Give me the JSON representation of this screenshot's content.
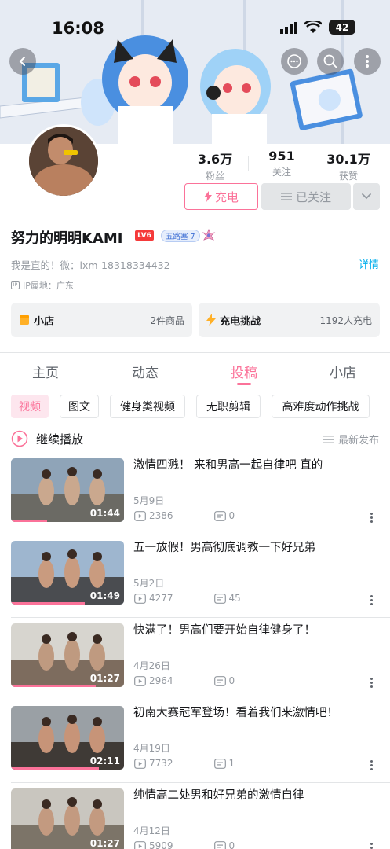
{
  "status": {
    "time": "16:08",
    "battery": "42"
  },
  "profile": {
    "stats": [
      {
        "value": "3.6万",
        "label": "粉丝"
      },
      {
        "value": "951",
        "label": "关注"
      },
      {
        "value": "30.1万",
        "label": "获赞"
      }
    ],
    "charge_label": "充电",
    "followed_label": "已关注",
    "name": "努力的明明KAMI",
    "level": "LV6",
    "fan_badge": "五路塞 7",
    "bio": "我是直的！微：lxm-18318334432",
    "detail_link": "详情",
    "ip": "IP属地：广东"
  },
  "cards": {
    "shop": {
      "title": "小店",
      "meta": "2件商品"
    },
    "charge": {
      "title": "充电挑战",
      "meta": "1192人充电"
    }
  },
  "tabs": [
    "主页",
    "动态",
    "投稿",
    "小店"
  ],
  "active_tab": "投稿",
  "chips": [
    "视频",
    "图文",
    "健身类视频",
    "无职剪辑",
    "高难度动作挑战"
  ],
  "continue_label": "继续播放",
  "sort_label": "最新发布",
  "videos": [
    {
      "title": "激情四溅！ 来和男高一起自律吧 直的",
      "date": "5月9日",
      "views": "2386",
      "comments": "0",
      "duration": "01:44",
      "progress": 0.32
    },
    {
      "title": "五一放假！男高彻底调教一下好兄弟",
      "date": "5月2日",
      "views": "4277",
      "comments": "45",
      "duration": "01:49",
      "progress": 0.65
    },
    {
      "title": "快满了！男高们要开始自律健身了！",
      "date": "4月26日",
      "views": "2964",
      "comments": "0",
      "duration": "01:27",
      "progress": 0.75
    },
    {
      "title": "初南大赛冠军登场！看着我们来激情吧！",
      "date": "4月19日",
      "views": "7732",
      "comments": "1",
      "duration": "02:11",
      "progress": 0.78
    },
    {
      "title": "纯情高二处男和好兄弟的激情自律",
      "date": "4月12日",
      "views": "5909",
      "comments": "0",
      "duration": "01:27",
      "progress": 0.0
    }
  ],
  "colors": {
    "accent": "#fb7299",
    "link": "#00aeec",
    "text": "#18191c",
    "muted": "#9499a0"
  }
}
